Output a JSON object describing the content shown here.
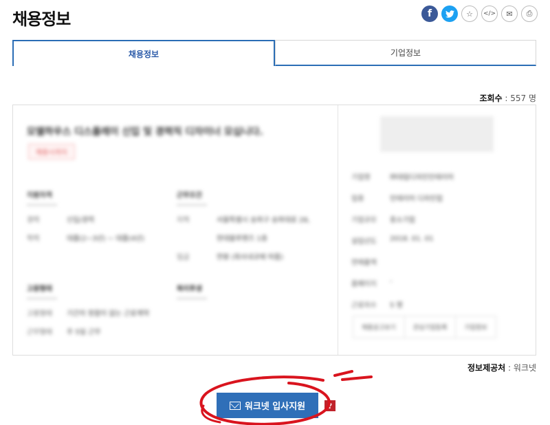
{
  "page": {
    "title": "채용정보"
  },
  "share": {
    "fb": "f",
    "tw": "t",
    "star": "☆",
    "code": "</>",
    "mail": "✉",
    "print": "⎙"
  },
  "tabs": [
    {
      "label": "채용정보"
    },
    {
      "label": "기업정보"
    }
  ],
  "views": {
    "label": "조회수",
    "value": " : 557 명"
  },
  "job": {
    "title": "모델하우스 디스플레이 신입 및 경력직 디자이너 모십니다.",
    "status": "채용시까지",
    "requirements": {
      "heading": "지원자격",
      "rows": [
        {
          "k": "경력",
          "v": "신입/경력"
        },
        {
          "k": "학력",
          "v": "대졸(2~3년) ~ 대졸(4년)"
        }
      ]
    },
    "conditions": {
      "heading": "근무조건",
      "rows": [
        {
          "k": "지역",
          "v": "서울특별시 송파구 송파대로 28,"
        },
        {
          "k": "",
          "v": "현대블루핸즈 1층"
        },
        {
          "k": "임금",
          "v": "연봉 (회사내규에 따름)"
        }
      ]
    },
    "hiring": {
      "heading": "고용형태",
      "rows": [
        {
          "k": "고용형태",
          "v": "기간의 정함이 없는 근로계약"
        },
        {
          "k": "근무형태",
          "v": "주 5일 근무"
        }
      ]
    },
    "welfare": {
      "heading": "복리후생"
    }
  },
  "company": {
    "rows": [
      {
        "k": "기업명",
        "v": "㈜대림디자인인테리어"
      },
      {
        "k": "업종",
        "v": "인테리어 디자인업"
      },
      {
        "k": "기업규모",
        "v": "중소기업"
      },
      {
        "k": "설립년도",
        "v": "2018. 01. 01"
      },
      {
        "k": "연매출액",
        "v": ""
      },
      {
        "k": "홈페이지",
        "v": "-"
      },
      {
        "k": "근로자수",
        "v": "5 명"
      }
    ],
    "buttons": [
      "채용공고보기",
      "관심기업등록",
      "기업정보"
    ]
  },
  "provider": {
    "label": "정보제공처",
    "value": " : 워크넷"
  },
  "apply": {
    "label": "워크넷 입사지원",
    "help": "?"
  },
  "colors": {
    "accent": "#2f6fb8",
    "tab_border": "#2a6db5",
    "help": "#c0232b",
    "annotation": "#d9141e"
  }
}
